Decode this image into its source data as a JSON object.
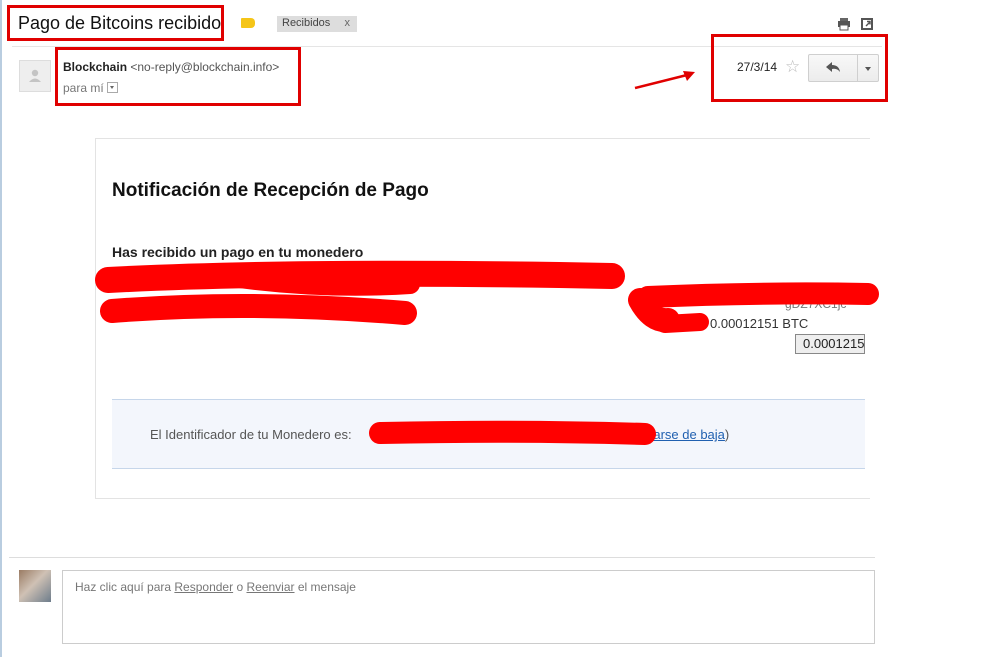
{
  "email": {
    "subject": "Pago de Bitcoins recibido",
    "label_chip": "Recibidos",
    "label_chip_close": "x",
    "sender_name": "Blockchain",
    "sender_email": "<no-reply@blockchain.info>",
    "to_text": "para mí",
    "date": "27/3/14"
  },
  "body": {
    "heading": "Notificación de Recepción de Pago",
    "subheading": "Has recibido un pago en tu monedero",
    "partial_hidden_text": "gDZ7XC1jc",
    "amount_btc": "0.00012151 BTC",
    "amount_button": "0.00012151",
    "wallet_id_label": "El Identificador de tu Monedero es:",
    "paren_open": "(",
    "unsubscribe_link": "Darse de baja",
    "paren_close": ")"
  },
  "reply": {
    "prefix": "Haz clic aquí para",
    "reply_link": "Responder",
    "or": "o",
    "forward_link": "Reenviar",
    "suffix": "el mensaje"
  },
  "colors": {
    "annotation_red": "#e00000",
    "link_blue": "#2060b0",
    "label_yellow": "#f5c518"
  },
  "icons": {
    "print": "print-icon",
    "new_window": "new-window-icon",
    "star": "star-icon",
    "reply": "reply-arrow-icon",
    "more": "chevron-down-icon"
  }
}
